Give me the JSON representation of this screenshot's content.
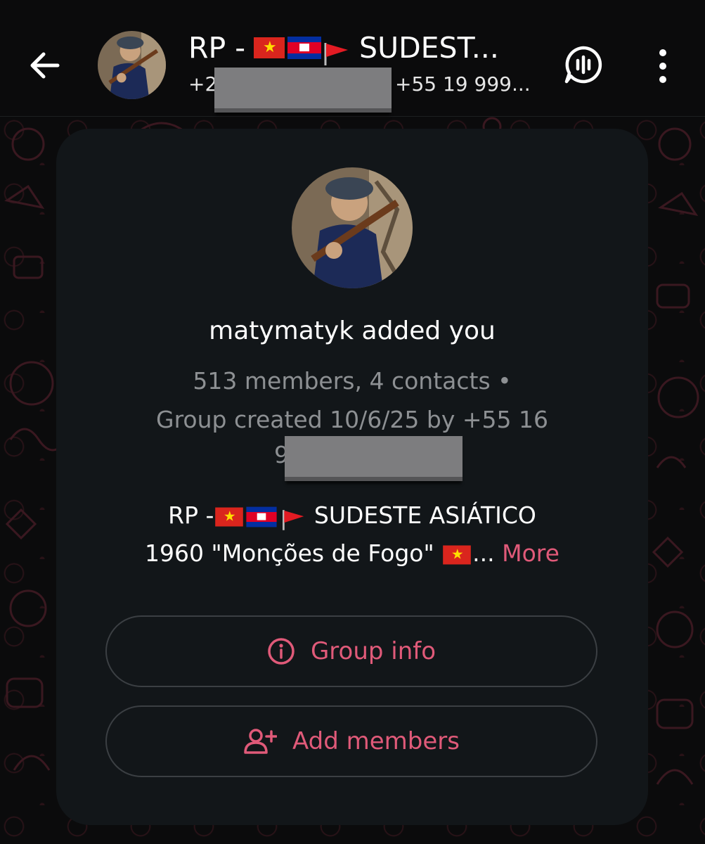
{
  "header": {
    "title_prefix": "RP -",
    "title_suffix": "SUDEST...",
    "subtitle_left": "+2",
    "subtitle_right": "+55 19 999...",
    "icons": {
      "back": "arrow-left-icon",
      "call": "voice-chat-icon",
      "menu": "more-vertical-icon"
    }
  },
  "card": {
    "added_text": "matymatyk added you",
    "members_text": "513 members, 4 contacts  •",
    "created_text": "Group created 10/6/25 by +55 16",
    "created_overflow": "9",
    "description_line1_prefix": "RP -",
    "description_line1_suffix": "SUDESTE ASIÁTICO",
    "description_line2": "1960 \"Monções de Fogo\"",
    "description_ellipsis": "...",
    "more_label": "More",
    "group_info_label": "Group info",
    "add_members_label": "Add members"
  },
  "colors": {
    "accent": "#e05a79",
    "card_bg": "#121619",
    "background": "#0b0b0c",
    "muted_text": "#8d9093"
  }
}
